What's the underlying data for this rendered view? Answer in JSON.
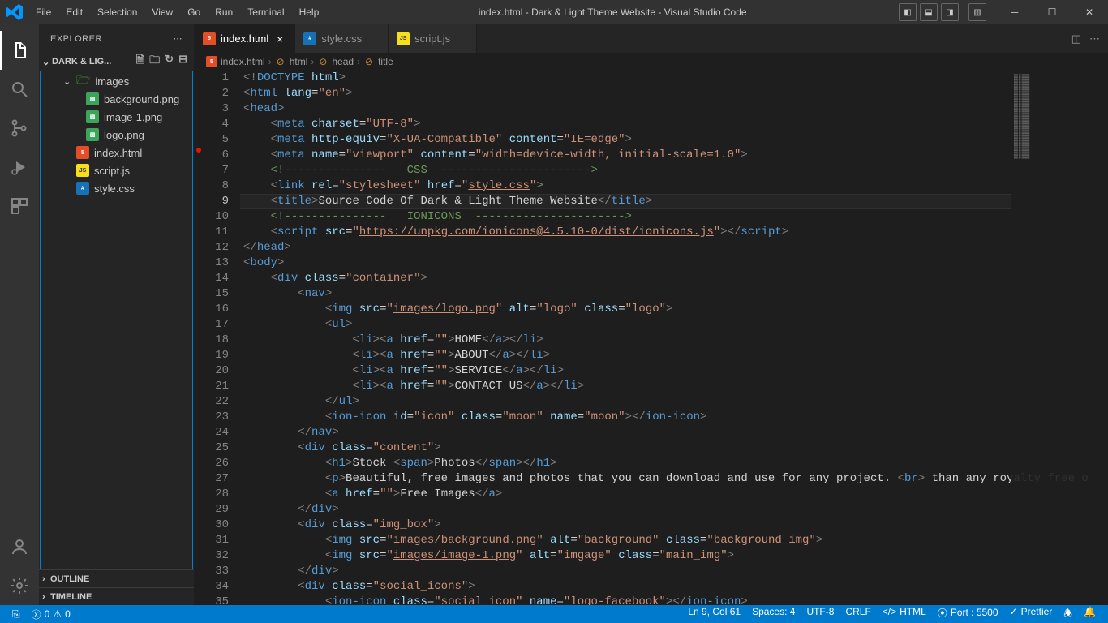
{
  "title": "index.html - Dark & Light Theme Website - Visual Studio Code",
  "menu": [
    "File",
    "Edit",
    "Selection",
    "View",
    "Go",
    "Run",
    "Terminal",
    "Help"
  ],
  "sidebar": {
    "title": "EXPLORER",
    "folder_label": "DARK & LIG...",
    "outline": "OUTLINE",
    "timeline": "TIMELINE",
    "tree": [
      {
        "type": "folder",
        "label": "images",
        "depth": 1,
        "open": true
      },
      {
        "type": "img",
        "label": "background.png",
        "depth": 2
      },
      {
        "type": "img",
        "label": "image-1.png",
        "depth": 2
      },
      {
        "type": "img",
        "label": "logo.png",
        "depth": 2
      },
      {
        "type": "html",
        "label": "index.html",
        "depth": 1
      },
      {
        "type": "js",
        "label": "script.js",
        "depth": 1
      },
      {
        "type": "css",
        "label": "style.css",
        "depth": 1
      }
    ]
  },
  "tabs": [
    {
      "icon": "html",
      "label": "index.html",
      "active": true,
      "close": true
    },
    {
      "icon": "css",
      "label": "style.css",
      "active": false,
      "close": false
    },
    {
      "icon": "js",
      "label": "script.js",
      "active": false,
      "close": false
    }
  ],
  "breadcrumb": [
    "index.html",
    "html",
    "head",
    "title"
  ],
  "status": {
    "remote": "",
    "errors": "0",
    "warnings": "0",
    "ln_col": "Ln 9, Col 61",
    "spaces": "Spaces: 4",
    "encoding": "UTF-8",
    "eol": "CRLF",
    "lang": "HTML",
    "port": "Port : 5500",
    "prettier": "Prettier"
  },
  "code": {
    "current_line": 9,
    "breakpoint_line": 6,
    "total_lines": 35,
    "lines_html": [
      "<span class='c-br'>&lt;!</span><span class='c-doc'>DOCTYPE</span> <span class='c-attr'>html</span><span class='c-br'>&gt;</span>",
      "<span class='c-br'>&lt;</span><span class='c-tag'>html</span> <span class='c-attr'>lang</span><span class='c-text'>=</span><span class='c-str'>\"en\"</span><span class='c-br'>&gt;</span>",
      "<span class='c-br'>&lt;</span><span class='c-tag'>head</span><span class='c-br'>&gt;</span>",
      "    <span class='c-br'>&lt;</span><span class='c-tag'>meta</span> <span class='c-attr'>charset</span><span class='c-text'>=</span><span class='c-str'>\"UTF-8\"</span><span class='c-br'>&gt;</span>",
      "    <span class='c-br'>&lt;</span><span class='c-tag'>meta</span> <span class='c-attr'>http-equiv</span><span class='c-text'>=</span><span class='c-str'>\"X-UA-Compatible\"</span> <span class='c-attr'>content</span><span class='c-text'>=</span><span class='c-str'>\"IE=edge\"</span><span class='c-br'>&gt;</span>",
      "    <span class='c-br'>&lt;</span><span class='c-tag'>meta</span> <span class='c-attr'>name</span><span class='c-text'>=</span><span class='c-str'>\"viewport\"</span> <span class='c-attr'>content</span><span class='c-text'>=</span><span class='c-str'>\"width=device-width, initial-scale=1.0\"</span><span class='c-br'>&gt;</span>",
      "    <span class='c-comm'>&lt;!---------------   CSS  ----------------------&gt;</span>",
      "    <span class='c-br'>&lt;</span><span class='c-tag'>link</span> <span class='c-attr'>rel</span><span class='c-text'>=</span><span class='c-str'>\"stylesheet\"</span> <span class='c-attr'>href</span><span class='c-text'>=</span><span class='c-str'>\"<span class='c-ul'>style.css</span>\"</span><span class='c-br'>&gt;</span>",
      "    <span class='c-br'>&lt;</span><span class='c-tag'>title</span><span class='c-br'>&gt;</span><span class='c-text'>Source Code Of Dark &amp; Light Theme Website</span><span class='c-br'>&lt;/</span><span class='c-tag'>title</span><span class='c-br'>&gt;</span>",
      "    <span class='c-comm'>&lt;!---------------   IONICONS  ----------------------&gt;</span>",
      "    <span class='c-br'>&lt;</span><span class='c-tag'>script</span> <span class='c-attr'>src</span><span class='c-text'>=</span><span class='c-str'>\"<span class='c-ul'>https://unpkg.com/ionicons@4.5.10-0/dist/ionicons.js</span>\"</span><span class='c-br'>&gt;&lt;/</span><span class='c-tag'>script</span><span class='c-br'>&gt;</span>",
      "<span class='c-br'>&lt;/</span><span class='c-tag'>head</span><span class='c-br'>&gt;</span>",
      "<span class='c-br'>&lt;</span><span class='c-tag'>body</span><span class='c-br'>&gt;</span>",
      "    <span class='c-br'>&lt;</span><span class='c-tag'>div</span> <span class='c-attr'>class</span><span class='c-text'>=</span><span class='c-str'>\"container\"</span><span class='c-br'>&gt;</span>",
      "        <span class='c-br'>&lt;</span><span class='c-tag'>nav</span><span class='c-br'>&gt;</span>",
      "            <span class='c-br'>&lt;</span><span class='c-tag'>img</span> <span class='c-attr'>src</span><span class='c-text'>=</span><span class='c-str'>\"<span class='c-ul'>images/logo.png</span>\"</span> <span class='c-attr'>alt</span><span class='c-text'>=</span><span class='c-str'>\"logo\"</span> <span class='c-attr'>class</span><span class='c-text'>=</span><span class='c-str'>\"logo\"</span><span class='c-br'>&gt;</span>",
      "            <span class='c-br'>&lt;</span><span class='c-tag'>ul</span><span class='c-br'>&gt;</span>",
      "                <span class='c-br'>&lt;</span><span class='c-tag'>li</span><span class='c-br'>&gt;&lt;</span><span class='c-tag'>a</span> <span class='c-attr'>href</span><span class='c-text'>=</span><span class='c-str'>\"\"</span><span class='c-br'>&gt;</span><span class='c-text'>HOME</span><span class='c-br'>&lt;/</span><span class='c-tag'>a</span><span class='c-br'>&gt;&lt;/</span><span class='c-tag'>li</span><span class='c-br'>&gt;</span>",
      "                <span class='c-br'>&lt;</span><span class='c-tag'>li</span><span class='c-br'>&gt;&lt;</span><span class='c-tag'>a</span> <span class='c-attr'>href</span><span class='c-text'>=</span><span class='c-str'>\"\"</span><span class='c-br'>&gt;</span><span class='c-text'>ABOUT</span><span class='c-br'>&lt;/</span><span class='c-tag'>a</span><span class='c-br'>&gt;&lt;/</span><span class='c-tag'>li</span><span class='c-br'>&gt;</span>",
      "                <span class='c-br'>&lt;</span><span class='c-tag'>li</span><span class='c-br'>&gt;&lt;</span><span class='c-tag'>a</span> <span class='c-attr'>href</span><span class='c-text'>=</span><span class='c-str'>\"\"</span><span class='c-br'>&gt;</span><span class='c-text'>SERVICE</span><span class='c-br'>&lt;/</span><span class='c-tag'>a</span><span class='c-br'>&gt;&lt;/</span><span class='c-tag'>li</span><span class='c-br'>&gt;</span>",
      "                <span class='c-br'>&lt;</span><span class='c-tag'>li</span><span class='c-br'>&gt;&lt;</span><span class='c-tag'>a</span> <span class='c-attr'>href</span><span class='c-text'>=</span><span class='c-str'>\"\"</span><span class='c-br'>&gt;</span><span class='c-text'>CONTACT US</span><span class='c-br'>&lt;/</span><span class='c-tag'>a</span><span class='c-br'>&gt;&lt;/</span><span class='c-tag'>li</span><span class='c-br'>&gt;</span>",
      "            <span class='c-br'>&lt;/</span><span class='c-tag'>ul</span><span class='c-br'>&gt;</span>",
      "            <span class='c-br'>&lt;</span><span class='c-tag'>ion-icon</span> <span class='c-attr'>id</span><span class='c-text'>=</span><span class='c-str'>\"icon\"</span> <span class='c-attr'>class</span><span class='c-text'>=</span><span class='c-str'>\"moon\"</span> <span class='c-attr'>name</span><span class='c-text'>=</span><span class='c-str'>\"moon\"</span><span class='c-br'>&gt;&lt;/</span><span class='c-tag'>ion-icon</span><span class='c-br'>&gt;</span>",
      "        <span class='c-br'>&lt;/</span><span class='c-tag'>nav</span><span class='c-br'>&gt;</span>",
      "        <span class='c-br'>&lt;</span><span class='c-tag'>div</span> <span class='c-attr'>class</span><span class='c-text'>=</span><span class='c-str'>\"content\"</span><span class='c-br'>&gt;</span>",
      "            <span class='c-br'>&lt;</span><span class='c-tag'>h1</span><span class='c-br'>&gt;</span><span class='c-text'>Stock </span><span class='c-br'>&lt;</span><span class='c-tag'>span</span><span class='c-br'>&gt;</span><span class='c-text'>Photos</span><span class='c-br'>&lt;/</span><span class='c-tag'>span</span><span class='c-br'>&gt;&lt;/</span><span class='c-tag'>h1</span><span class='c-br'>&gt;</span>",
      "            <span class='c-br'>&lt;</span><span class='c-tag'>p</span><span class='c-br'>&gt;</span><span class='c-text'>Beautiful, free images and photos that you can download and use for any project. </span><span class='c-br'>&lt;</span><span class='c-tag'>br</span><span class='c-br'>&gt;</span><span class='c-text'> than any royalty free o</span>",
      "            <span class='c-br'>&lt;</span><span class='c-tag'>a</span> <span class='c-attr'>href</span><span class='c-text'>=</span><span class='c-str'>\"\"</span><span class='c-br'>&gt;</span><span class='c-text'>Free Images</span><span class='c-br'>&lt;/</span><span class='c-tag'>a</span><span class='c-br'>&gt;</span>",
      "        <span class='c-br'>&lt;/</span><span class='c-tag'>div</span><span class='c-br'>&gt;</span>",
      "        <span class='c-br'>&lt;</span><span class='c-tag'>div</span> <span class='c-attr'>class</span><span class='c-text'>=</span><span class='c-str'>\"img_box\"</span><span class='c-br'>&gt;</span>",
      "            <span class='c-br'>&lt;</span><span class='c-tag'>img</span> <span class='c-attr'>src</span><span class='c-text'>=</span><span class='c-str'>\"<span class='c-ul'>images/background.png</span>\"</span> <span class='c-attr'>alt</span><span class='c-text'>=</span><span class='c-str'>\"background\"</span> <span class='c-attr'>class</span><span class='c-text'>=</span><span class='c-str'>\"background_img\"</span><span class='c-br'>&gt;</span>",
      "            <span class='c-br'>&lt;</span><span class='c-tag'>img</span> <span class='c-attr'>src</span><span class='c-text'>=</span><span class='c-str'>\"<span class='c-ul'>images/image-1.png</span>\"</span> <span class='c-attr'>alt</span><span class='c-text'>=</span><span class='c-str'>\"imgage\"</span> <span class='c-attr'>class</span><span class='c-text'>=</span><span class='c-str'>\"main_img\"</span><span class='c-br'>&gt;</span>",
      "        <span class='c-br'>&lt;/</span><span class='c-tag'>div</span><span class='c-br'>&gt;</span>",
      "        <span class='c-br'>&lt;</span><span class='c-tag'>div</span> <span class='c-attr'>class</span><span class='c-text'>=</span><span class='c-str'>\"social_icons\"</span><span class='c-br'>&gt;</span>",
      "            <span class='c-br'>&lt;</span><span class='c-tag'>ion-icon</span> <span class='c-attr'>class</span><span class='c-text'>=</span><span class='c-str'>\"social_icon\"</span> <span class='c-attr'>name</span><span class='c-text'>=</span><span class='c-str'>\"logo-facebook\"</span><span class='c-br'>&gt;&lt;/</span><span class='c-tag'>ion-icon</span><span class='c-br'>&gt;</span>"
    ]
  }
}
